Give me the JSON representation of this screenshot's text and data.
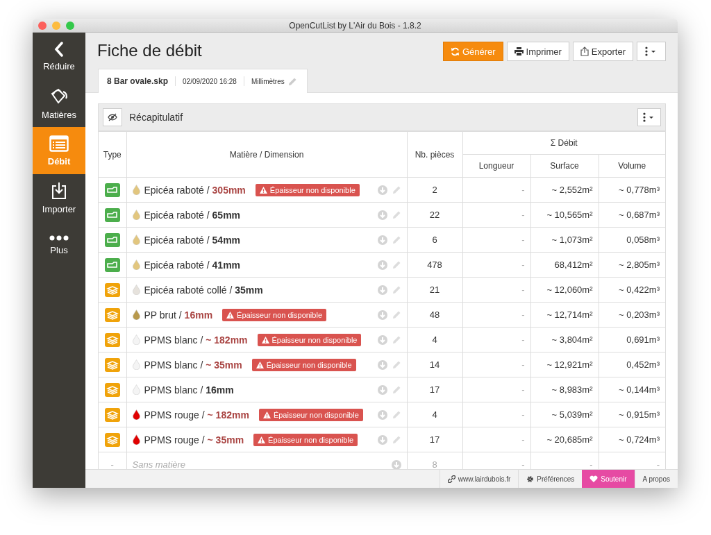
{
  "window": {
    "title": "OpenCutList by L'Air du Bois - 1.8.2"
  },
  "sidebar": {
    "items": [
      {
        "kind": "back",
        "label": "Réduire",
        "selected": false
      },
      {
        "kind": "materials",
        "label": "Matières",
        "selected": false
      },
      {
        "kind": "cutlist",
        "label": "Débit",
        "selected": true
      },
      {
        "kind": "import",
        "label": "Importer",
        "selected": false
      },
      {
        "kind": "more",
        "label": "Plus",
        "selected": false
      }
    ]
  },
  "page_title": "Fiche de débit",
  "toolbar": [
    {
      "kind": "generate",
      "label": "Générer",
      "primary": true
    },
    {
      "kind": "print",
      "label": "Imprimer",
      "primary": false
    },
    {
      "kind": "export",
      "label": "Exporter",
      "primary": false
    },
    {
      "kind": "menu",
      "primary": false
    }
  ],
  "file_tab": {
    "filename": "8 Bar ovale.skp",
    "date": "02/09/2020 16:28",
    "unit": "Millimètres"
  },
  "section": {
    "title": "Récapitulatif"
  },
  "table": {
    "columns": {
      "type": "Type",
      "material": "Matière / Dimension",
      "count": "Nb. pièces",
      "group": "Σ Débit",
      "length": "Longueur",
      "surface": "Surface",
      "volume": "Volume"
    },
    "rows": [
      {
        "kind": "solid_wood",
        "color": "#e2c67e",
        "label": "Epicéa raboté / **305mm**",
        "dimension_warning": true,
        "badge": "Épaisseur non disponible",
        "count": "2",
        "length": "-",
        "surface": "~ 2,552m²",
        "volume": "~ 0,778m³"
      },
      {
        "kind": "solid_wood",
        "color": "#e2c67e",
        "label": "Epicéa raboté / **65mm**",
        "dimension_warning": false,
        "count": "22",
        "length": "-",
        "surface": "~ 10,565m²",
        "volume": "~ 0,687m³"
      },
      {
        "kind": "solid_wood",
        "color": "#e2c67e",
        "label": "Epicéa raboté / **54mm**",
        "dimension_warning": false,
        "count": "6",
        "length": "-",
        "surface": "~ 1,073m²",
        "volume": "0,058m³"
      },
      {
        "kind": "solid_wood",
        "color": "#e2c67e",
        "label": "Epicéa raboté / **41mm**",
        "dimension_warning": false,
        "count": "478",
        "length": "-",
        "surface": "68,412m²",
        "volume": "~ 2,805m³"
      },
      {
        "kind": "sheet_good",
        "color": "#e6e2dc",
        "label": "Epicéa raboté collé / **35mm**",
        "dimension_warning": false,
        "count": "21",
        "length": "-",
        "surface": "~ 12,060m²",
        "volume": "~ 0,422m³"
      },
      {
        "kind": "sheet_good",
        "color": "#b8994c",
        "label": "PP brut / **16mm**",
        "dimension_warning": true,
        "badge": "Épaisseur non disponible",
        "count": "48",
        "length": "-",
        "surface": "~ 12,714m²",
        "volume": "~ 0,203m³"
      },
      {
        "kind": "sheet_good",
        "color": "#f4f4f4",
        "label": "PPMS blanc / **~ 182mm**",
        "dimension_warning": true,
        "badge": "Épaisseur non disponible",
        "count": "4",
        "length": "-",
        "surface": "~ 3,804m²",
        "volume": "0,691m³"
      },
      {
        "kind": "sheet_good",
        "color": "#f4f4f4",
        "label": "PPMS blanc / **~ 35mm**",
        "dimension_warning": true,
        "badge": "Épaisseur non disponible",
        "count": "14",
        "length": "-",
        "surface": "~ 12,921m²",
        "volume": "0,452m³"
      },
      {
        "kind": "sheet_good",
        "color": "#f4f4f4",
        "label": "PPMS blanc / **16mm**",
        "dimension_warning": false,
        "count": "17",
        "length": "-",
        "surface": "~ 8,983m²",
        "volume": "~ 0,144m³"
      },
      {
        "kind": "sheet_good",
        "color": "#e00000",
        "label": "PPMS rouge / **~ 182mm**",
        "dimension_warning": true,
        "badge": "Épaisseur non disponible",
        "count": "4",
        "length": "-",
        "surface": "~ 5,039m²",
        "volume": "~ 0,915m³"
      },
      {
        "kind": "sheet_good",
        "color": "#e00000",
        "label": "PPMS rouge / **~ 35mm**",
        "dimension_warning": true,
        "badge": "Épaisseur non disponible",
        "count": "17",
        "length": "-",
        "surface": "~ 20,685m²",
        "volume": "~ 0,724m³"
      },
      {
        "kind": "none",
        "type": "-",
        "label": "Sans matière",
        "count": "8",
        "length": "-",
        "surface": "-",
        "volume": "-"
      }
    ]
  },
  "footer": [
    {
      "kind": "link",
      "label": "www.lairdubois.fr"
    },
    {
      "kind": "preferences",
      "label": "Préférences"
    },
    {
      "kind": "support",
      "label": "Soutenir"
    },
    {
      "kind": "about",
      "label": "A propos"
    }
  ]
}
